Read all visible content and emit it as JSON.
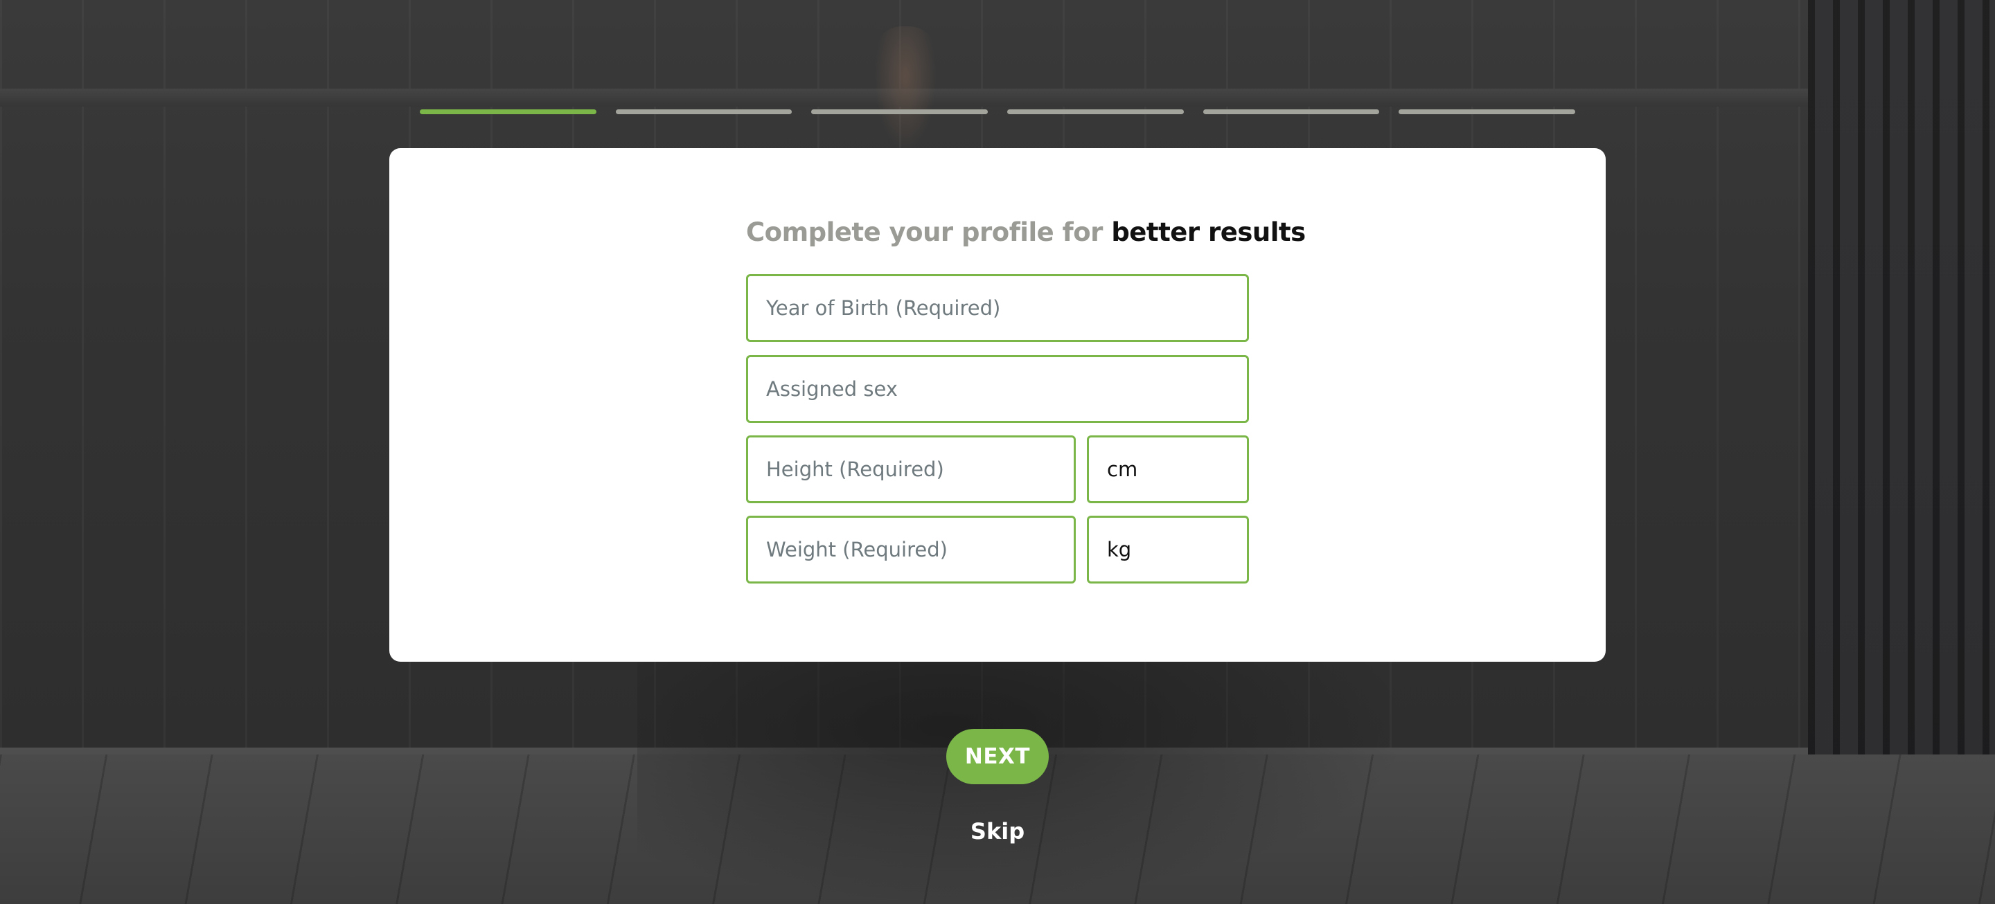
{
  "progress": {
    "total_steps": 6,
    "current_step": 1,
    "active_color": "#7ab648",
    "inactive_color": "#a3a49c"
  },
  "card": {
    "heading_muted": "Complete your profile for",
    "heading_strong": "better results",
    "fields": {
      "year_of_birth_placeholder": "Year of Birth (Required)",
      "assigned_sex_placeholder": "Assigned sex",
      "height_placeholder": "Height (Required)",
      "height_unit": "cm",
      "weight_placeholder": "Weight (Required)",
      "weight_unit": "kg"
    }
  },
  "actions": {
    "next_label": "NEXT",
    "skip_label": "Skip"
  },
  "colors": {
    "accent": "#7ab648",
    "card_background": "#ffffff",
    "placeholder_text": "#6f7a7f"
  },
  "background": {
    "description_icon": "yoga-photo-background"
  }
}
